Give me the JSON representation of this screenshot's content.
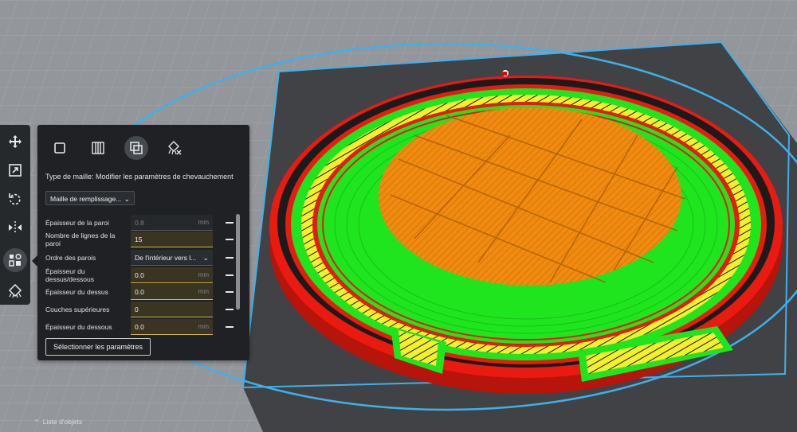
{
  "toolbar": {
    "tools": [
      {
        "icon": "move-icon"
      },
      {
        "icon": "scale-icon"
      },
      {
        "icon": "rotate-icon"
      },
      {
        "icon": "mirror-icon"
      },
      {
        "icon": "per-model-settings-icon",
        "active": true
      },
      {
        "icon": "support-blocker-icon"
      }
    ]
  },
  "panel": {
    "mesh_types": [
      {
        "icon": "normal-model-icon"
      },
      {
        "icon": "support-mesh-icon"
      },
      {
        "icon": "overlap-mesh-icon",
        "active": true
      },
      {
        "icon": "support-blocker-mesh-icon"
      }
    ],
    "mesh_type_label": "Type de maille: Modifier les paramètres de chevauchement",
    "infill_select": "Maille de remplissage...",
    "settings": [
      {
        "label": "Épaisseur de la paroi",
        "value": "0.8",
        "unit": "mm"
      },
      {
        "label": "Nombre de lignes de la paroi",
        "value": "15",
        "unit": ""
      },
      {
        "label": "Ordre des parois",
        "value": "De l'intérieur vers l...",
        "unit": ""
      },
      {
        "label": "Épaisseur du dessus/dessous",
        "value": "0.0",
        "unit": "mm"
      },
      {
        "label": "Épaisseur du dessus",
        "value": "0.0",
        "unit": "mm"
      },
      {
        "label": "Couches supérieures",
        "value": "0",
        "unit": ""
      },
      {
        "label": "Épaisseur du dessous",
        "value": "0.0",
        "unit": "mm"
      }
    ],
    "select_settings_button": "Sélectionner les paramètres"
  },
  "footer": {
    "object_list": "Liste d'objets"
  },
  "colors": {
    "background": "#8e9196",
    "build_plate": "#3b3d40",
    "outline": "#3fb0ea",
    "wall": "#ea1a10",
    "skin": "#1fe51f",
    "infill": "#f08a10",
    "support": "#f2ee30"
  }
}
